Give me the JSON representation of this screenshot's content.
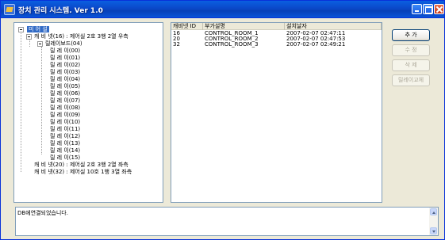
{
  "window": {
    "title": "장치 관리 시스템. Ver 1.0",
    "colors": {
      "titlebar": "#0a5fe0",
      "selection": "#316ac5",
      "face": "#ece9d8"
    }
  },
  "tree": {
    "root": "미 어 설",
    "cabinets": [
      {
        "label": "캐 비 넷(16) : 제어실 2호 3행 2열 우측",
        "expanded": true
      },
      {
        "label": "캐 비 넷(20) : 제어실 2호 3행 2열 좌측",
        "expanded": false
      },
      {
        "label": "캐 비 넷(32) : 제어실 10호 1행 3열 좌측",
        "expanded": false
      }
    ],
    "board": "릴레이보드(04)",
    "relays": [
      "릴 레 이(00)",
      "릴 레 이(01)",
      "릴 레 이(02)",
      "릴 레 이(03)",
      "릴 레 이(04)",
      "릴 레 이(05)",
      "릴 레 이(06)",
      "릴 레 이(07)",
      "릴 레 이(08)",
      "릴 레 이(09)",
      "릴 레 이(10)",
      "릴 레 이(11)",
      "릴 레 이(12)",
      "릴 레 이(13)",
      "릴 레 이(14)",
      "릴 레 이(15)"
    ]
  },
  "list": {
    "columns": [
      "캐비넷 ID",
      "부가설명",
      "설치날자"
    ],
    "rows": [
      [
        "16",
        "CONTROL_ROOM_1",
        "2007-02-07 02:47:11"
      ],
      [
        "20",
        "CONTROL_ROOM_2",
        "2007-02-07 02:47:53"
      ],
      [
        "32",
        "CONTROL_ROOM_3",
        "2007-02-07 02:49:21"
      ]
    ]
  },
  "buttons": {
    "add": "추 가",
    "edit": "수 정",
    "delete": "삭 제",
    "relay_swap": "릴레이교체"
  },
  "log": {
    "text": "DB에연결되었습니다."
  }
}
